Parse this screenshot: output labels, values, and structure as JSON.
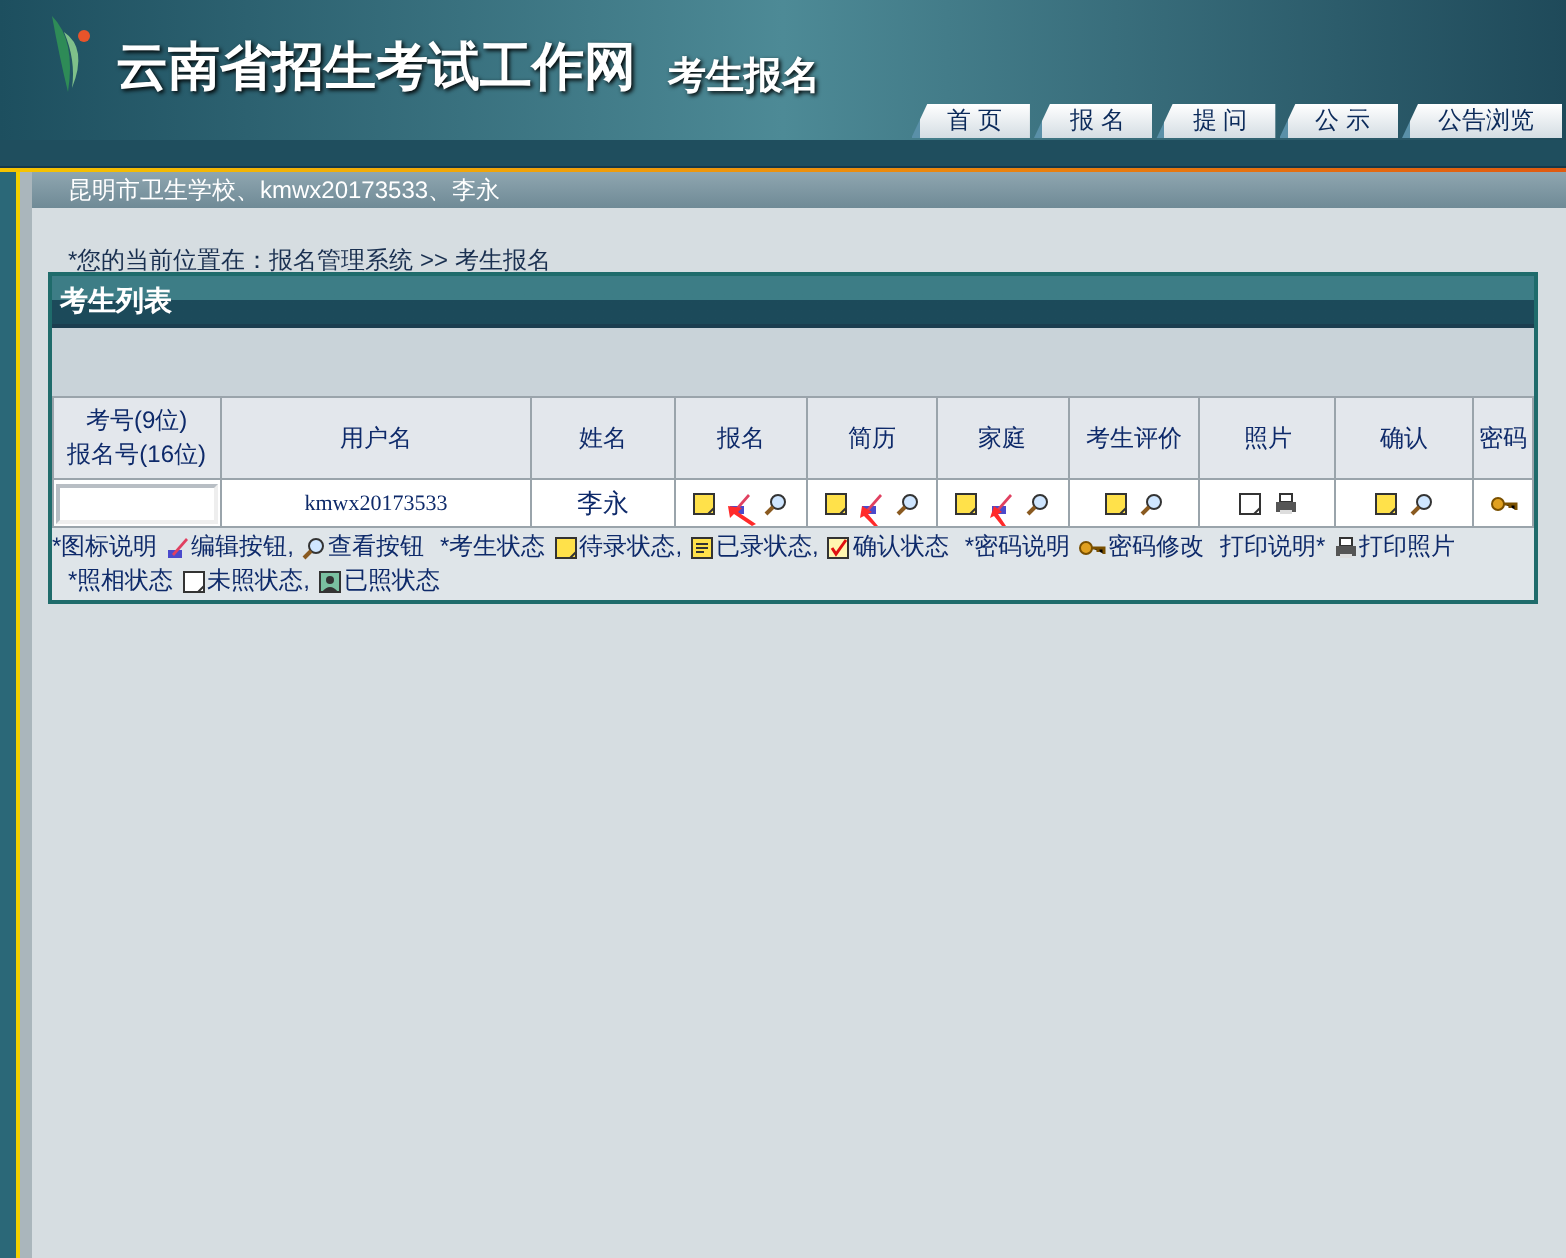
{
  "header": {
    "site_title": "云南省招生考试工作网",
    "subtitle": "考生报名"
  },
  "nav": [
    {
      "label": "首 页"
    },
    {
      "label": "报 名"
    },
    {
      "label": "提 问"
    },
    {
      "label": "公 示"
    },
    {
      "label": "公告浏览"
    }
  ],
  "user_bar": "昆明市卫生学校、kmwx20173533、李永",
  "breadcrumb": "*您的当前位置在：报名管理系统 >> 考生报名",
  "panel": {
    "title": "考生列表",
    "columns": [
      {
        "lines": [
          "考号(9位)",
          "报名号(16位)"
        ]
      },
      {
        "lines": [
          "用户名"
        ]
      },
      {
        "lines": [
          "姓名"
        ]
      },
      {
        "lines": [
          "报名"
        ]
      },
      {
        "lines": [
          "简历"
        ]
      },
      {
        "lines": [
          "家庭"
        ]
      },
      {
        "lines": [
          "考生评价"
        ]
      },
      {
        "lines": [
          "照片"
        ]
      },
      {
        "lines": [
          "确认"
        ]
      },
      {
        "lines": [
          "密码"
        ]
      }
    ],
    "rows": [
      {
        "username": "kmwx20173533",
        "name": "李永"
      }
    ],
    "legend": [
      {
        "kind": "text",
        "text": "*图标说明"
      },
      {
        "kind": "edit",
        "text": "编辑按钮,"
      },
      {
        "kind": "view",
        "text": "查看按钮"
      },
      {
        "kind": "text",
        "text": "*考生状态"
      },
      {
        "kind": "pending",
        "text": "待录状态,"
      },
      {
        "kind": "recorded",
        "text": "已录状态,"
      },
      {
        "kind": "confirmed",
        "text": "确认状态"
      },
      {
        "kind": "text",
        "text": "*密码说明"
      },
      {
        "kind": "key",
        "text": "密码修改"
      },
      {
        "kind": "text",
        "text": "打印说明*"
      },
      {
        "kind": "print",
        "text": "打印照片"
      },
      {
        "kind": "break"
      },
      {
        "kind": "text",
        "text": "*照相状态"
      },
      {
        "kind": "blank",
        "text": "未照状态,"
      },
      {
        "kind": "photo",
        "text": "已照状态"
      }
    ]
  }
}
